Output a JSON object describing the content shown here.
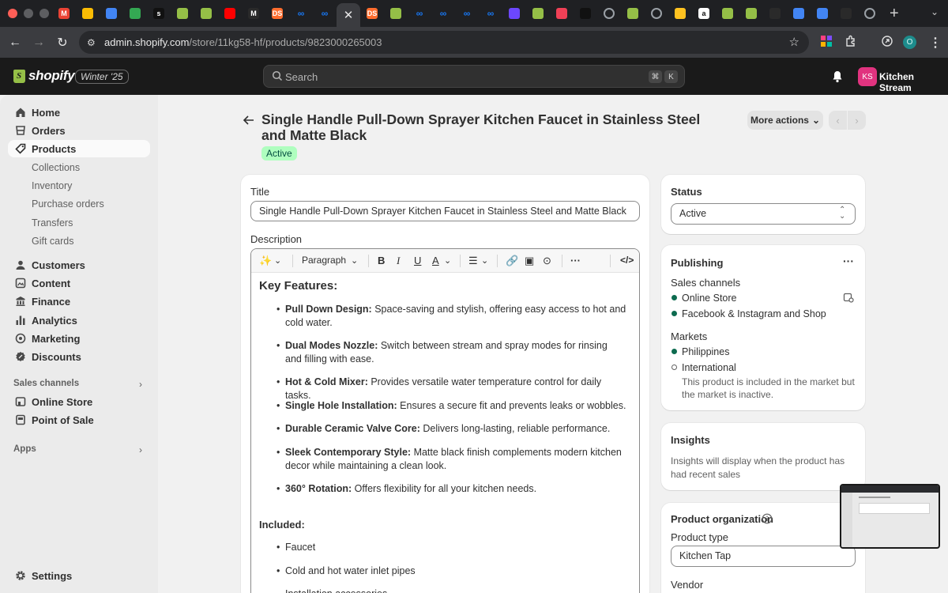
{
  "browser": {
    "tabs": [
      {
        "icon": "gmail-icon",
        "label": "M",
        "color": "#ea4335"
      },
      {
        "icon": "google-photos-icon",
        "label": "",
        "color": "#fbbc04"
      },
      {
        "icon": "google-docs-icon",
        "label": "",
        "color": "#4285f4"
      },
      {
        "icon": "google-drive-icon",
        "label": "",
        "color": "#34a853"
      },
      {
        "icon": "s-icon",
        "label": "s",
        "color": "#111111"
      },
      {
        "icon": "shopify-icon",
        "label": "",
        "color": "#95bf47"
      },
      {
        "icon": "shopify-icon",
        "label": "",
        "color": "#95bf47"
      },
      {
        "icon": "youtube-icon",
        "label": "",
        "color": "#ff0000"
      },
      {
        "icon": "m-icon",
        "label": "M",
        "color": "#2a2a2a"
      },
      {
        "icon": "ds-icon",
        "label": "DS",
        "color": "#ff6d2e"
      },
      {
        "icon": "meta-icon",
        "label": "",
        "color": "#1877f2"
      },
      {
        "icon": "meta-icon",
        "label": "",
        "color": "#1877f2"
      },
      {
        "icon": "close-icon",
        "label": "",
        "color": "#3b3c40"
      },
      {
        "icon": "ds-icon",
        "label": "DS",
        "color": "#ff6d2e"
      },
      {
        "icon": "shopify-icon",
        "label": "",
        "color": "#95bf47"
      },
      {
        "icon": "meta-icon",
        "label": "",
        "color": "#1877f2"
      },
      {
        "icon": "meta-icon",
        "label": "",
        "color": "#1877f2"
      },
      {
        "icon": "meta-icon",
        "label": "",
        "color": "#1877f2"
      },
      {
        "icon": "meta-icon",
        "label": "",
        "color": "#1877f2"
      },
      {
        "icon": "d-icon",
        "label": "",
        "color": "#6c47ff"
      },
      {
        "icon": "shopify-icon",
        "label": "",
        "color": "#95bf47"
      },
      {
        "icon": "pocket-icon",
        "label": "",
        "color": "#ef4056"
      },
      {
        "icon": "tiktok-icon",
        "label": "",
        "color": "#111111"
      },
      {
        "icon": "globe-icon",
        "label": "",
        "color": "#9aa0a6"
      },
      {
        "icon": "shopify-icon",
        "label": "",
        "color": "#95bf47"
      },
      {
        "icon": "globe-icon",
        "label": "",
        "color": "#9aa0a6"
      },
      {
        "icon": "walmart-icon",
        "label": "",
        "color": "#ffc220"
      },
      {
        "icon": "amazon-icon",
        "label": "a",
        "color": "#ffffff"
      },
      {
        "icon": "shopify-icon",
        "label": "",
        "color": "#95bf47"
      },
      {
        "icon": "shopify-icon",
        "label": "",
        "color": "#95bf47"
      },
      {
        "icon": "openai-icon",
        "label": "",
        "color": "#2a2a2a"
      },
      {
        "icon": "google-docs-icon",
        "label": "",
        "color": "#4285f4"
      },
      {
        "icon": "google-docs-icon",
        "label": "",
        "color": "#4285f4"
      },
      {
        "icon": "chart-icon",
        "label": "",
        "color": "#2a2a2a"
      },
      {
        "icon": "globe-icon",
        "label": "",
        "color": "#9aa0a6"
      }
    ],
    "new_tab": "+",
    "url_host": "admin.shopify.com",
    "url_path": "/store/11kg58-hf/products/9823000265003",
    "profile_initial": "O"
  },
  "topbar": {
    "brand": "shopify",
    "edition": "Winter '25",
    "search_placeholder": "Search",
    "shortcut_1": "⌘",
    "shortcut_2": "K",
    "store_initials": "KS",
    "store_name": "Kitchen Stream"
  },
  "sidebar": {
    "items": [
      {
        "label": "Home",
        "icon": "home-icon"
      },
      {
        "label": "Orders",
        "icon": "orders-icon"
      },
      {
        "label": "Products",
        "icon": "tag-icon"
      },
      {
        "label": "Customers",
        "icon": "person-icon"
      },
      {
        "label": "Content",
        "icon": "content-icon"
      },
      {
        "label": "Finance",
        "icon": "bank-icon"
      },
      {
        "label": "Analytics",
        "icon": "bar-chart-icon"
      },
      {
        "label": "Marketing",
        "icon": "target-icon"
      },
      {
        "label": "Discounts",
        "icon": "discount-icon"
      }
    ],
    "products_sub": [
      "Collections",
      "Inventory",
      "Purchase orders",
      "Transfers",
      "Gift cards"
    ],
    "sales_channels_heading": "Sales channels",
    "channels": [
      {
        "label": "Online Store",
        "icon": "store-icon"
      },
      {
        "label": "Point of Sale",
        "icon": "pos-icon"
      }
    ],
    "apps_heading": "Apps",
    "settings": "Settings"
  },
  "product": {
    "title": "Single Handle Pull-Down Sprayer Kitchen Faucet in Stainless Steel and Matte Black",
    "status_badge": "Active",
    "more_actions": "More actions",
    "title_label": "Title",
    "title_value": "Single Handle Pull-Down Sprayer Kitchen Faucet in Stainless Steel and Matte Black",
    "description_label": "Description",
    "toolbar_paragraph": "Paragraph",
    "key_features_heading": "Key Features:",
    "features": [
      {
        "name": "Pull Down Design:",
        "text": " Space-saving and stylish, offering easy access to hot and cold water."
      },
      {
        "name": "Dual Modes Nozzle:",
        "text": " Switch between stream and spray modes for rinsing and filling with ease."
      },
      {
        "name": "Hot & Cold Mixer:",
        "text": " Provides versatile water temperature control for daily tasks."
      },
      {
        "name": "Single Hole Installation:",
        "text": " Ensures a secure fit and prevents leaks or wobbles."
      },
      {
        "name": "Durable Ceramic Valve Core:",
        "text": " Delivers long-lasting, reliable performance."
      },
      {
        "name": "Sleek Contemporary Style:",
        "text": " Matte black finish complements modern kitchen decor while maintaining a clean look."
      },
      {
        "name": "360° Rotation:",
        "text": " Offers flexibility for all your kitchen needs."
      }
    ],
    "included_heading": "Included:",
    "included": [
      "Faucet",
      "Cold and hot water inlet pipes",
      "Installation accessories"
    ]
  },
  "status_card": {
    "heading": "Status",
    "value": "Active"
  },
  "publishing": {
    "heading": "Publishing",
    "sales_channels_label": "Sales channels",
    "channels": [
      "Online Store",
      "Facebook & Instagram and Shop"
    ],
    "markets_label": "Markets",
    "markets": [
      "Philippines",
      "International"
    ],
    "market_note": "This product is included in the market but the market is inactive."
  },
  "insights": {
    "heading": "Insights",
    "text": "Insights will display when the product has had recent sales"
  },
  "organization": {
    "heading": "Product organization",
    "type_label": "Product type",
    "type_value": "Kitchen Tap",
    "vendor_label": "Vendor"
  }
}
